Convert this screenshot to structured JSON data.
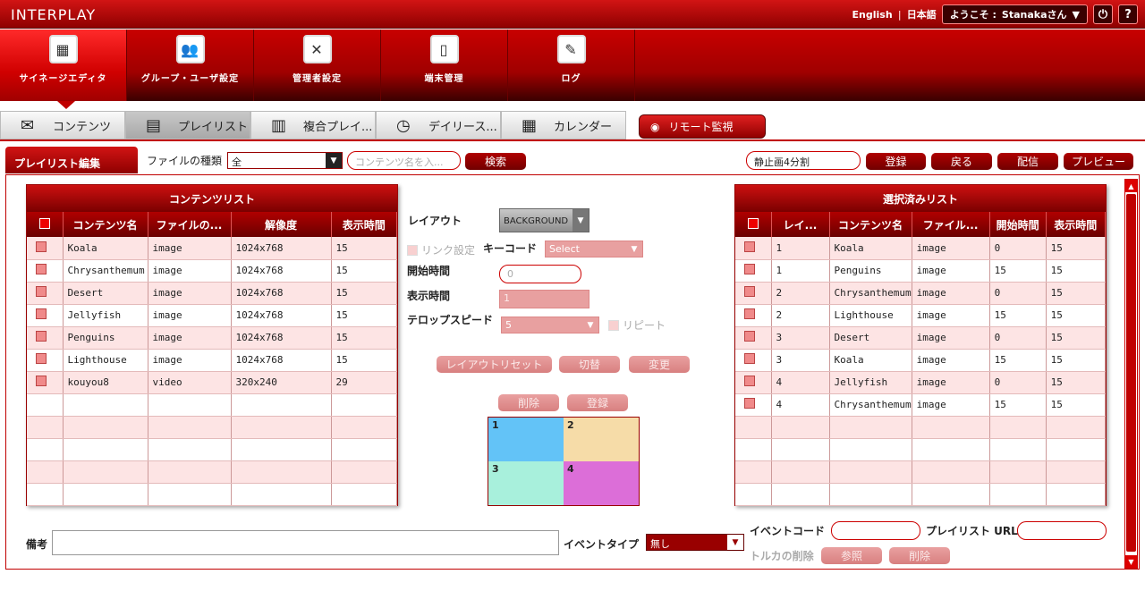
{
  "app": {
    "title": "INTERPLAY"
  },
  "header": {
    "lang_en": "English",
    "lang_sep": "|",
    "lang_ja": "日本語",
    "welcome": "ようこそ :",
    "user": "Stanakaさん",
    "power_icon": "power-icon",
    "help_label": "?"
  },
  "mainnav": [
    {
      "label": "サイネージエディタ",
      "icon": "grid-edit-icon"
    },
    {
      "label": "グループ・ユーザ設定",
      "icon": "users-icon"
    },
    {
      "label": "管理者設定",
      "icon": "tools-icon"
    },
    {
      "label": "端末管理",
      "icon": "device-icon"
    },
    {
      "label": "ログ",
      "icon": "log-icon"
    }
  ],
  "subnav": [
    {
      "label": "コンテンツ"
    },
    {
      "label": "プレイリスト"
    },
    {
      "label": "複合プレイ..."
    },
    {
      "label": "デイリース..."
    },
    {
      "label": "カレンダー"
    }
  ],
  "remote": {
    "label": "リモート監視"
  },
  "toolbar": {
    "tab": "プレイリスト編集",
    "file_type_label": "ファイルの種類",
    "file_type_value": "全",
    "search_placeholder": "コンテンツ名を入...",
    "search_button": "検索",
    "playlist_name": "静止画4分割",
    "register": "登録",
    "back": "戻る",
    "deliver": "配信",
    "preview": "プレビュー"
  },
  "content_list": {
    "title": "コンテンツリスト",
    "columns": [
      "コンテンツ名",
      "ファイルの...",
      "解像度",
      "表示時間"
    ],
    "rows": [
      [
        "Koala",
        "image",
        "1024x768",
        "15"
      ],
      [
        "Chrysanthemum",
        "image",
        "1024x768",
        "15"
      ],
      [
        "Desert",
        "image",
        "1024x768",
        "15"
      ],
      [
        "Jellyfish",
        "image",
        "1024x768",
        "15"
      ],
      [
        "Penguins",
        "image",
        "1024x768",
        "15"
      ],
      [
        "Lighthouse",
        "image",
        "1024x768",
        "15"
      ],
      [
        "kouyou8",
        "video",
        "320x240",
        "29"
      ]
    ]
  },
  "selected_list": {
    "title": "選択済みリスト",
    "columns": [
      "レイ...",
      "コンテンツ名",
      "ファイル...",
      "開始時間",
      "表示時間"
    ],
    "rows": [
      [
        "1",
        "Koala",
        "image",
        "0",
        "15"
      ],
      [
        "1",
        "Penguins",
        "image",
        "15",
        "15"
      ],
      [
        "2",
        "Chrysanthemum",
        "image",
        "0",
        "15"
      ],
      [
        "2",
        "Lighthouse",
        "image",
        "15",
        "15"
      ],
      [
        "3",
        "Desert",
        "image",
        "0",
        "15"
      ],
      [
        "3",
        "Koala",
        "image",
        "15",
        "15"
      ],
      [
        "4",
        "Jellyfish",
        "image",
        "0",
        "15"
      ],
      [
        "4",
        "Chrysanthemum",
        "image",
        "15",
        "15"
      ]
    ]
  },
  "form": {
    "layout_label": "レイアウト",
    "layout_value": "BACKGROUND",
    "link_label": "リンク設定",
    "keycode_label": "キーコード",
    "keycode_value": "Select",
    "start_label": "開始時間",
    "start_value": "0",
    "duration_label": "表示時間",
    "duration_value": "1",
    "ticker_label": "テロップスピード",
    "ticker_value": "5",
    "repeat_label": "リピート",
    "reset_button": "レイアウトリセット",
    "switch_button": "切替",
    "change_button": "変更",
    "delete_button": "削除",
    "add_button": "登録",
    "cells": [
      "1",
      "2",
      "3",
      "4"
    ],
    "cell_colors": [
      "#63c3f7",
      "#f6dca8",
      "#a8f0dc",
      "#dc6ed8"
    ]
  },
  "bottom": {
    "notes_label": "備考",
    "event_type_label": "イベントタイプ",
    "event_type_value": "無し",
    "event_code_label": "イベントコード",
    "playlist_url_label": "プレイリスト URL",
    "output_delete_label": "トルカの削除",
    "browse_button": "参照",
    "delete_button": "削除"
  }
}
